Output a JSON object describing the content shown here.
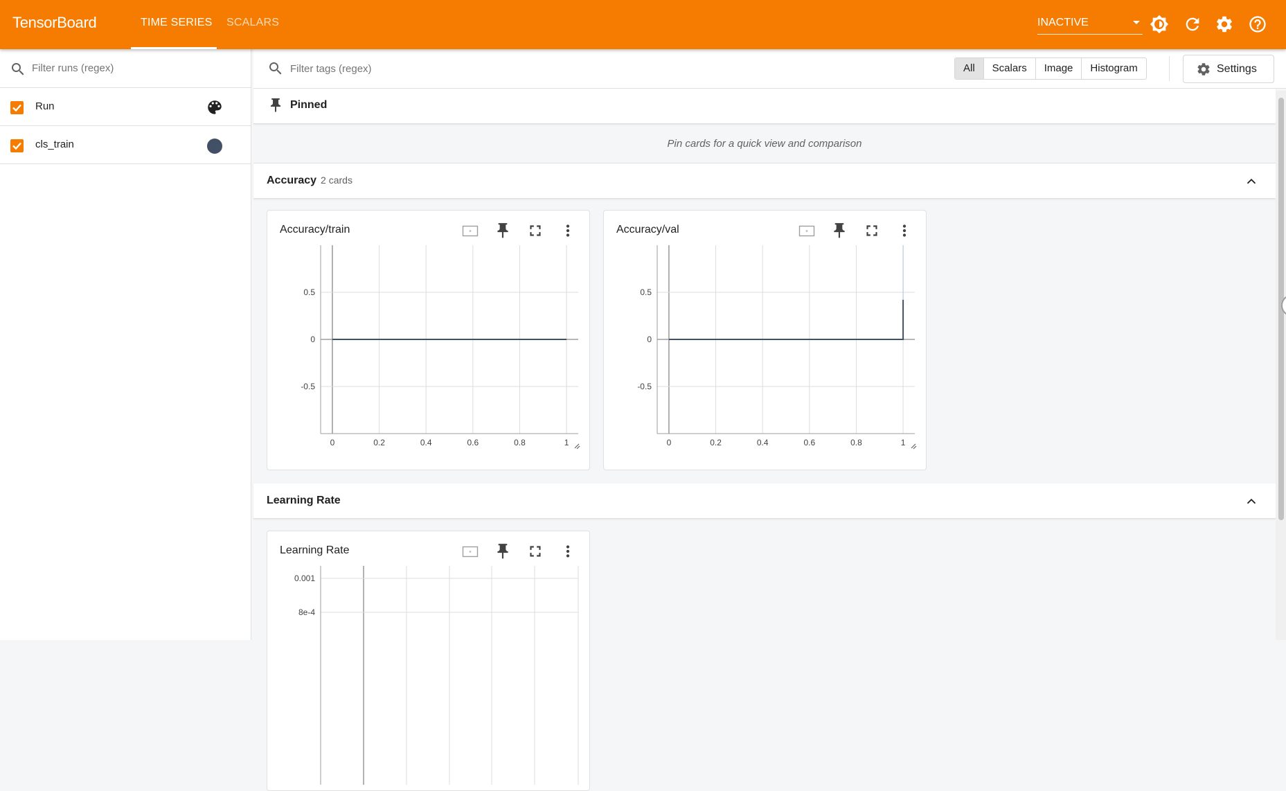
{
  "header": {
    "brand": "TensorBoard",
    "tabs": [
      {
        "label": "TIME SERIES",
        "active": true
      },
      {
        "label": "SCALARS",
        "active": false
      }
    ],
    "status_select": "INACTIVE",
    "icons": [
      "brightness-icon",
      "refresh-icon",
      "settings-icon",
      "help-icon"
    ],
    "accent_color": "#f57c00"
  },
  "sidebar": {
    "filter_placeholder": "Filter runs (regex)",
    "runs": [
      {
        "label": "Run",
        "checked": true,
        "icon": "palette-icon"
      },
      {
        "label": "cls_train",
        "checked": true,
        "color": "#425066"
      }
    ]
  },
  "toolbar": {
    "filter_placeholder": "Filter tags (regex)",
    "type_filters": [
      "All",
      "Scalars",
      "Image",
      "Histogram"
    ],
    "selected_filter": "All",
    "settings_label": "Settings"
  },
  "pinned": {
    "title": "Pinned",
    "empty_message": "Pin cards for a quick view and comparison"
  },
  "groups": [
    {
      "title": "Accuracy",
      "count_label": "2 cards"
    },
    {
      "title": "Learning Rate",
      "count_label": ""
    }
  ],
  "chart_data": [
    {
      "type": "line",
      "title": "Accuracy/train",
      "x": [
        0,
        1
      ],
      "series": [
        {
          "values": [
            0,
            0
          ],
          "color": "#425066"
        }
      ],
      "xticks": [
        "0",
        "0.2",
        "0.4",
        "0.6",
        "0.8",
        "1"
      ],
      "yticks": [
        "0.5",
        "0",
        "-0.5"
      ],
      "xlim": [
        -0.05,
        1.05
      ],
      "ylim": [
        -1,
        1
      ],
      "grid": true
    },
    {
      "type": "line",
      "title": "Accuracy/val",
      "x": [
        0,
        1,
        1
      ],
      "series": [
        {
          "values": [
            0,
            0,
            0.42
          ],
          "color": "#425066"
        }
      ],
      "xticks": [
        "0",
        "0.2",
        "0.4",
        "0.6",
        "0.8",
        "1"
      ],
      "yticks": [
        "0.5",
        "0",
        "-0.5"
      ],
      "xlim": [
        -0.05,
        1.05
      ],
      "ylim": [
        -1,
        1
      ],
      "grid": true
    },
    {
      "type": "line",
      "title": "Learning Rate",
      "x": [],
      "series": [],
      "xticks": [],
      "yticks": [
        "0.001",
        "8e-4"
      ],
      "grid": true
    }
  ]
}
